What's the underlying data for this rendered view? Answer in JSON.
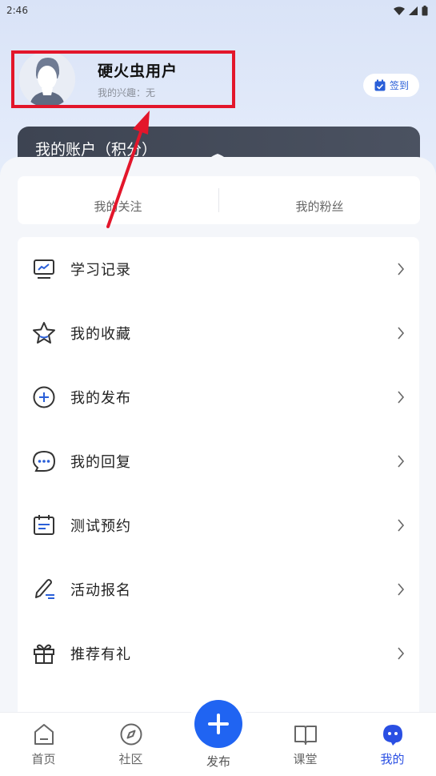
{
  "status_bar": {
    "time": "2:46"
  },
  "profile": {
    "username": "硬火虫用户",
    "interest": "我的兴趣：无"
  },
  "checkin": {
    "label": "签到",
    "icon": "calendar-check-icon"
  },
  "account": {
    "title": "我的账户（积分）"
  },
  "follow": {
    "following": "我的关注",
    "followers": "我的粉丝"
  },
  "menu": {
    "items": [
      {
        "label": "学习记录",
        "icon": "chart-monitor-icon"
      },
      {
        "label": "我的收藏",
        "icon": "star-icon"
      },
      {
        "label": "我的发布",
        "icon": "plus-circle-icon"
      },
      {
        "label": "我的回复",
        "icon": "chat-bubble-icon"
      },
      {
        "label": "测试预约",
        "icon": "calendar-icon"
      },
      {
        "label": "活动报名",
        "icon": "pen-icon"
      },
      {
        "label": "推荐有礼",
        "icon": "gift-icon"
      }
    ]
  },
  "nav": {
    "home": "首页",
    "community": "社区",
    "publish": "发布",
    "classroom": "课堂",
    "mine": "我的"
  },
  "colors": {
    "accent": "#2064f2",
    "highlight": "#e3162b",
    "account_card": "#444b59"
  }
}
